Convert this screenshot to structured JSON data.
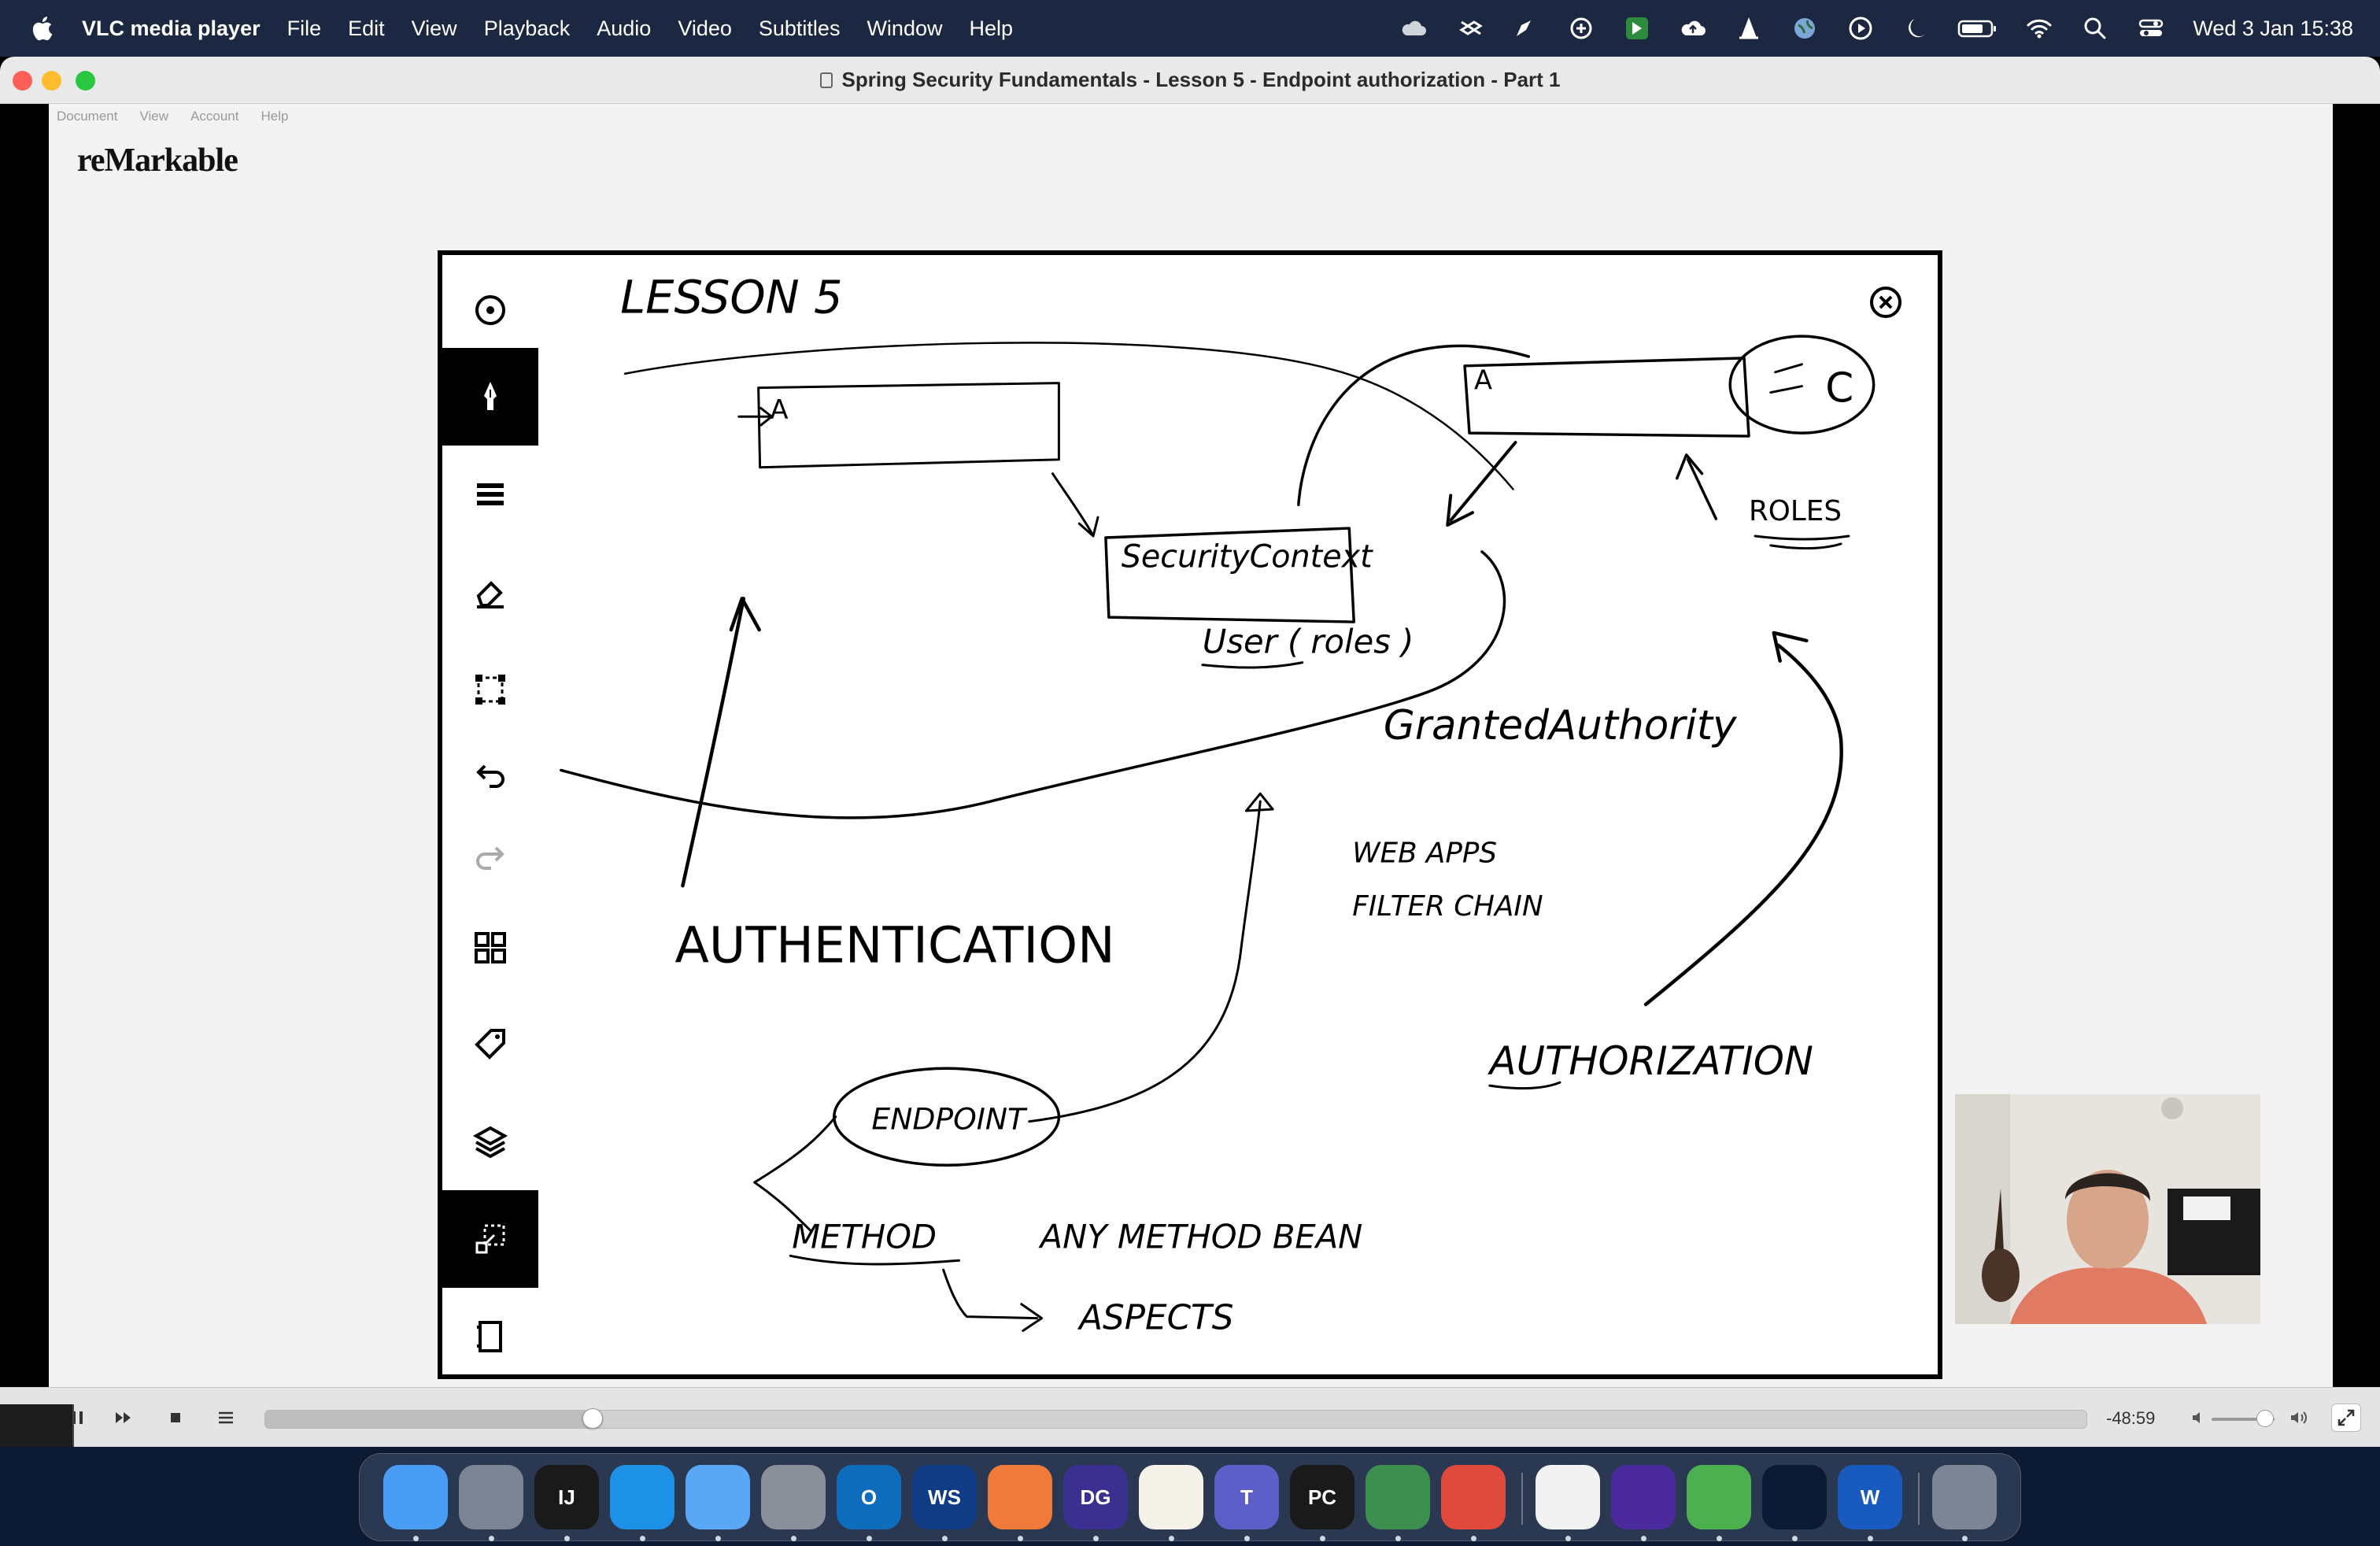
{
  "menubar": {
    "app_name": "VLC media player",
    "items": [
      "File",
      "Edit",
      "View",
      "Playback",
      "Audio",
      "Video",
      "Subtitles",
      "Window",
      "Help"
    ],
    "clock": "Wed 3 Jan  15:38",
    "status_icons": [
      "cloud-icon",
      "dropbox-icon",
      "paint-icon",
      "shield-icon",
      "app-icon",
      "upload-cloud-icon",
      "vlc-cone-icon",
      "globe-icon",
      "play-circle-icon",
      "moon-icon",
      "battery-icon",
      "wifi-icon",
      "search-icon",
      "control-center-icon"
    ]
  },
  "window": {
    "title": "Spring Security Fundamentals - Lesson 5 - Endpoint authorization - Part 1"
  },
  "remarkable": {
    "menu": [
      "Document",
      "View",
      "Account",
      "Help"
    ],
    "logo": "reMarkable",
    "tools": [
      "circle-menu-icon",
      "pen-icon",
      "brush-settings-icon",
      "eraser-icon",
      "selection-icon",
      "undo-icon",
      "redo-icon",
      "grid-icon",
      "tag-icon",
      "layers-icon",
      "move-icon",
      "notebook-icon"
    ],
    "handwriting": {
      "title": "LESSON 5",
      "box_a_left": "A",
      "box_a_right": "A",
      "security_context": "SecurityContext",
      "user_roles": "User ( roles )",
      "roles": "ROLES",
      "circle_c": "C",
      "granted_authority": "GrantedAuthority",
      "web_apps": "WEB APPS",
      "filter_chain": "FILTER CHAIN",
      "authentication": "AUTHENTICATION",
      "authorization": "AUTHORIZATION",
      "endpoint": "ENDPOINT",
      "method": "METHOD",
      "any_method_bean": "ANY METHOD BEAN",
      "aspects": "ASPECTS"
    }
  },
  "player": {
    "time_remaining": "-48:59",
    "progress": 0.18,
    "volume": 0.85
  },
  "dock": {
    "apps": [
      {
        "name": "finder",
        "label": "",
        "color": "#4a9df5"
      },
      {
        "name": "launchpad",
        "label": "",
        "color": "#7b8492"
      },
      {
        "name": "intellij",
        "label": "IJ",
        "color": "#1a1a1a"
      },
      {
        "name": "docker",
        "label": "",
        "color": "#1d91e6"
      },
      {
        "name": "mail",
        "label": "",
        "color": "#5aa7f5"
      },
      {
        "name": "system-settings",
        "label": "",
        "color": "#8a8f99"
      },
      {
        "name": "outlook",
        "label": "O",
        "color": "#0f6cbd"
      },
      {
        "name": "webstorm",
        "label": "WS",
        "color": "#0f3c84"
      },
      {
        "name": "pen-tool",
        "label": "",
        "color": "#f07a3a"
      },
      {
        "name": "datagrip",
        "label": "DG",
        "color": "#3b2f8f"
      },
      {
        "name": "notes",
        "label": "",
        "color": "#f4f1e8"
      },
      {
        "name": "teams",
        "label": "T",
        "color": "#5b5fc7"
      },
      {
        "name": "pycharm",
        "label": "PC",
        "color": "#1a1a1a"
      },
      {
        "name": "network-app",
        "label": "",
        "color": "#3d8f4f"
      },
      {
        "name": "tasks",
        "label": "",
        "color": "#e04a3d"
      },
      {
        "name": "chrome",
        "label": "",
        "color": "#f1f1f1"
      },
      {
        "name": "browser-purple",
        "label": "",
        "color": "#4b2a9e"
      },
      {
        "name": "cloud-app",
        "label": "",
        "color": "#4caf50"
      },
      {
        "name": "vlc",
        "label": "",
        "color": "#0c1a33"
      },
      {
        "name": "word",
        "label": "W",
        "color": "#185abd"
      },
      {
        "name": "trash",
        "label": "",
        "color": "#7c8593"
      }
    ]
  }
}
